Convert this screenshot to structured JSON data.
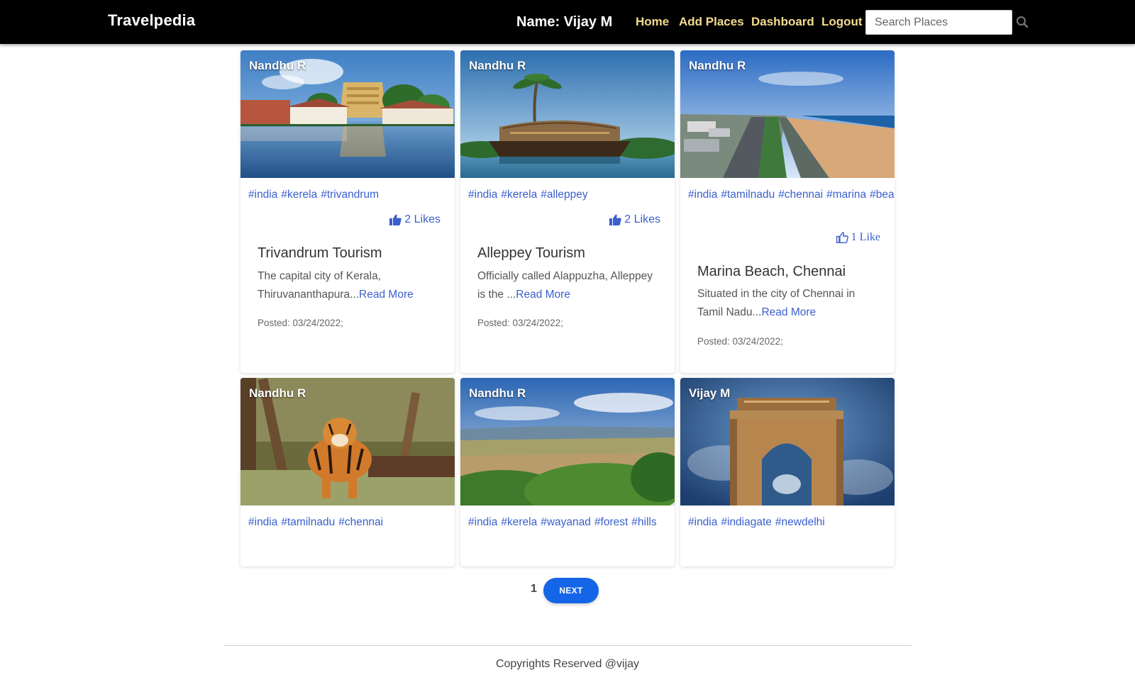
{
  "navbar": {
    "brand": "Travelpedia",
    "user_label": "Name: Vijay M",
    "links": [
      "Home",
      "Add Places",
      "Dashboard",
      "Logout"
    ],
    "search_placeholder": "Search Places",
    "search_icon": "search-icon"
  },
  "cards": [
    {
      "author": "Nandhu R",
      "tags": [
        "#india",
        "#kerela",
        "#trivandrum"
      ],
      "likes": "2 Likes",
      "title": "Trivandrum Tourism",
      "desc": "The capital city of Kerala, Thiruvananthapura...",
      "read_more": "Read More",
      "posted": "Posted: 03/24/2022;"
    },
    {
      "author": "Nandhu R",
      "tags": [
        "#india",
        "#kerela",
        "#alleppey"
      ],
      "likes": "2 Likes",
      "title": "Alleppey Tourism",
      "desc": "Officially called Alappuzha, Alleppey is the ...",
      "read_more": "Read More",
      "posted": "Posted: 03/24/2022;"
    },
    {
      "author": "Nandhu R",
      "tags": [
        "#india",
        "#tamilnadu",
        "#chennai",
        "#marina",
        "#beach"
      ],
      "likes": "1 Like",
      "title": "Marina Beach, Chennai",
      "desc": "Situated in the city of Chennai in Tamil Nadu...",
      "read_more": "Read More",
      "posted": "Posted: 03/24/2022;"
    },
    {
      "author": "Nandhu R",
      "tags": [
        "#india",
        "#tamilnadu",
        "#chennai"
      ]
    },
    {
      "author": "Nandhu R",
      "tags": [
        "#india",
        "#kerela",
        "#wayanad",
        "#forest",
        "#hills"
      ]
    },
    {
      "author": "Vijay M",
      "tags": [
        "#india",
        "#indiagate",
        "#newdelhi"
      ]
    }
  ],
  "pagination": {
    "current": "1",
    "next_label": "NEXT"
  },
  "footer": {
    "copyright": "Copyrights Reserved @vijay"
  },
  "colors": {
    "navbar_bg": "#000000",
    "nav_link": "#f3dc8e",
    "link_blue": "#3a5fcd",
    "next_button": "#1565e8"
  }
}
